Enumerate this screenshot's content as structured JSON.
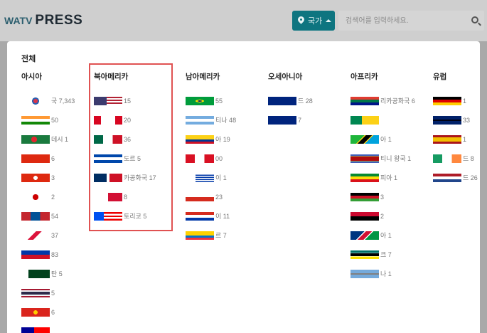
{
  "header": {
    "logo_watv": "WATV",
    "logo_press": "PRESS",
    "country_button_label": "국가",
    "search_placeholder": "검색어를 입력하세요."
  },
  "panel": {
    "all_label": "전체",
    "columns": [
      {
        "title": "아시아",
        "items": [
          {
            "flag": "kr",
            "text": "국 7,343"
          },
          {
            "flag": "in",
            "text": "50"
          },
          {
            "flag": "bd",
            "text": "데시 1"
          },
          {
            "flag": "cn",
            "text": "6"
          },
          {
            "flag": "hk",
            "text": "3"
          },
          {
            "flag": "jp",
            "text": "2"
          },
          {
            "flag": "mn",
            "text": "54"
          },
          {
            "flag": "np",
            "text": "37"
          },
          {
            "flag": "ph",
            "text": "83"
          },
          {
            "flag": "pk",
            "text": "탄 5"
          },
          {
            "flag": "th",
            "text": "5"
          },
          {
            "flag": "vn",
            "text": "6"
          },
          {
            "flag": "tw",
            "text": ""
          }
        ]
      },
      {
        "title": "북아메리카",
        "items": [
          {
            "flag": "us",
            "text": "15"
          },
          {
            "flag": "ca",
            "text": "20"
          },
          {
            "flag": "mx",
            "text": "36"
          },
          {
            "flag": "sv",
            "text": "도르 5"
          },
          {
            "flag": "do",
            "text": "카공화국 17"
          },
          {
            "flag": "pa",
            "text": "8"
          },
          {
            "flag": "pr",
            "text": "토리코 5"
          }
        ]
      },
      {
        "title": "남아메리카",
        "items": [
          {
            "flag": "br",
            "text": "55"
          },
          {
            "flag": "ar",
            "text": "티나 48"
          },
          {
            "flag": "co",
            "text": "아 19"
          },
          {
            "flag": "pe",
            "text": "00"
          },
          {
            "flag": "uy",
            "text": "이 1"
          },
          {
            "flag": "cl",
            "text": "23"
          },
          {
            "flag": "py",
            "text": "이 11"
          },
          {
            "flag": "ec",
            "text": "르 7"
          }
        ]
      },
      {
        "title": "오세아니아",
        "items": [
          {
            "flag": "au",
            "text": "드 28"
          },
          {
            "flag": "nz",
            "text": "7"
          }
        ]
      },
      {
        "title": "아프리카",
        "items": [
          {
            "flag": "za",
            "text": "리카공화국 6"
          },
          {
            "flag": "bj",
            "text": ""
          },
          {
            "flag": "tz",
            "text": "아 1"
          },
          {
            "flag": "sz",
            "text": "티니 왕국 1"
          },
          {
            "flag": "et",
            "text": "피아 1"
          },
          {
            "flag": "mw",
            "text": "3"
          },
          {
            "flag": "ao",
            "text": "2"
          },
          {
            "flag": "na",
            "text": "아 1"
          },
          {
            "flag": "mz",
            "text": "크 7"
          },
          {
            "flag": "bw",
            "text": "나 1"
          }
        ]
      },
      {
        "title": "유럽",
        "items": [
          {
            "flag": "de",
            "text": "1"
          },
          {
            "flag": "gb",
            "text": "33"
          },
          {
            "flag": "es",
            "text": "1"
          },
          {
            "flag": "ie",
            "text": "드 8"
          },
          {
            "flag": "nl",
            "text": "드 26"
          }
        ]
      }
    ]
  },
  "colors": {
    "accent": "#0e7580",
    "highlight_border": "#e05252"
  }
}
